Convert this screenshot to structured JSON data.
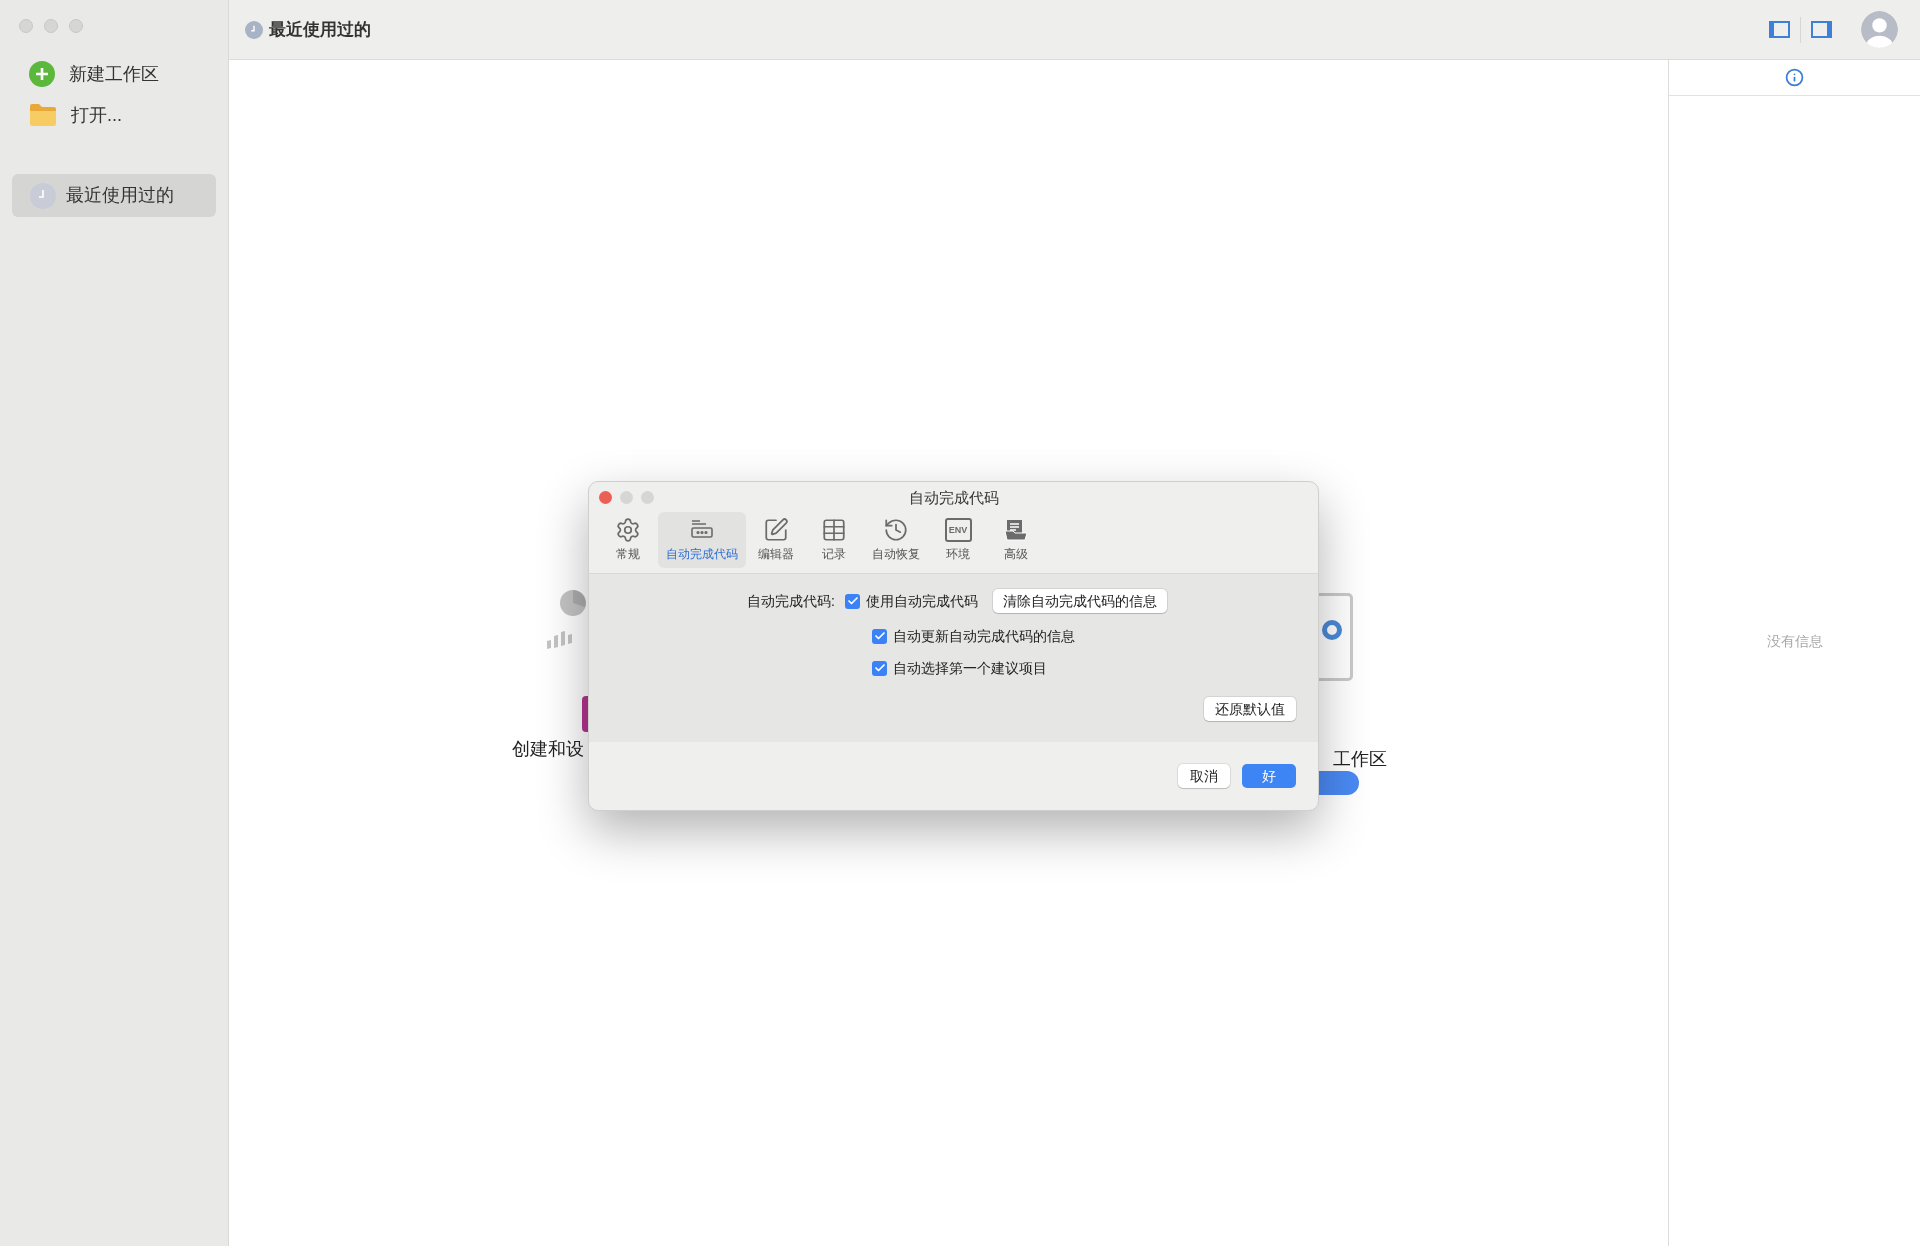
{
  "sidebar": {
    "actions": [
      {
        "kind": "new",
        "label": "新建工作区"
      },
      {
        "kind": "open",
        "label": "打开..."
      }
    ],
    "items": [
      {
        "label": "最近使用过的",
        "selected": true
      }
    ]
  },
  "toolbar": {
    "title": "最近使用过的"
  },
  "info_panel": {
    "empty_text": "没有信息"
  },
  "background": {
    "left_caption": "创建和设",
    "right_caption": "工作区"
  },
  "dialog": {
    "title": "自动完成代码",
    "tabs": [
      {
        "kind": "gear",
        "label": "常规",
        "selected": false
      },
      {
        "kind": "autocomplete",
        "label": "自动完成代码",
        "selected": true
      },
      {
        "kind": "editor",
        "label": "编辑器",
        "selected": false
      },
      {
        "kind": "records",
        "label": "记录",
        "selected": false
      },
      {
        "kind": "history",
        "label": "自动恢复",
        "selected": false
      },
      {
        "kind": "env",
        "icon_text": "ENV",
        "label": "环境",
        "selected": false
      },
      {
        "kind": "advanced",
        "label": "高级",
        "selected": false
      }
    ],
    "field_label": "自动完成代码:",
    "checkboxes": [
      {
        "label": "使用自动完成代码",
        "checked": true
      },
      {
        "label": "自动更新自动完成代码的信息",
        "checked": true
      },
      {
        "label": "自动选择第一个建议项目",
        "checked": true
      }
    ],
    "clear_button": "清除自动完成代码的信息",
    "restore_button": "还原默认值",
    "cancel_button": "取消",
    "ok_button": "好"
  }
}
